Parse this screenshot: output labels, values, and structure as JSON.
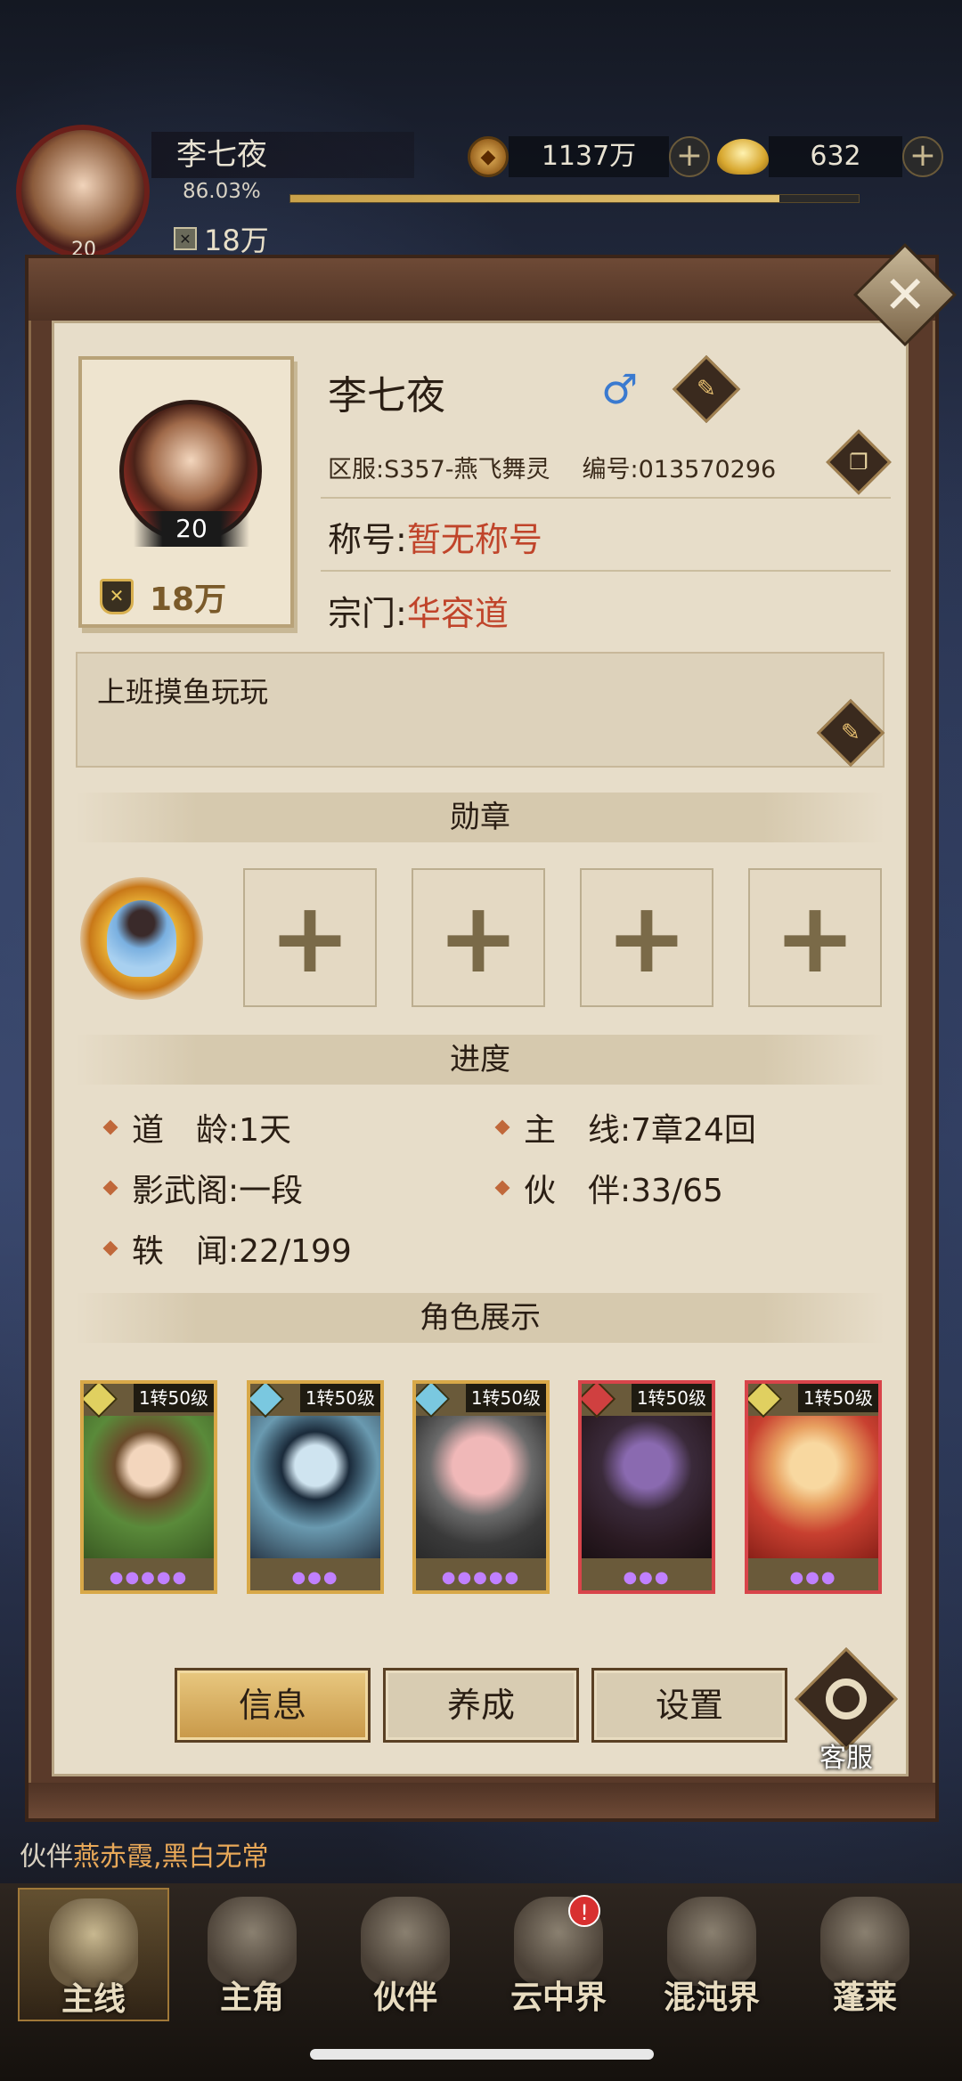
{
  "top": {
    "player_name": "李七夜",
    "level": "20",
    "exp_percent": "86.03%",
    "exp_fraction": 0.8603,
    "power": "18万",
    "coins": "1137万",
    "ingots": "632"
  },
  "profile": {
    "name": "李七夜",
    "gender_icon": "♂",
    "level": "20",
    "power": "18万",
    "server": "区服:S357-燕飞舞灵",
    "id": "编号:013570296",
    "title_label": "称号:",
    "title_value": "暂无称号",
    "sect_label": "宗门:",
    "sect_value": "华容道",
    "signature": "上班摸鱼玩玩"
  },
  "sections": {
    "medals": "勋章",
    "progress": "进度",
    "characters": "角色展示"
  },
  "progress": {
    "dao_age": "道　龄:1天",
    "main_line": "主　线:7章24回",
    "shadow_pavilion": "影武阁:一段",
    "partners": "伙　伴:33/65",
    "iron_news": "轶　闻:22/199"
  },
  "cards": [
    {
      "tag": "1转50级",
      "stars": 5,
      "gem": "yellow",
      "frame": "gold"
    },
    {
      "tag": "1转50级",
      "stars": 3,
      "gem": "blue",
      "frame": "gold"
    },
    {
      "tag": "1转50级",
      "stars": 5,
      "gem": "blue",
      "frame": "gold"
    },
    {
      "tag": "1转50级",
      "stars": 3,
      "gem": "red",
      "frame": "red"
    },
    {
      "tag": "1转50级",
      "stars": 3,
      "gem": "yellow",
      "frame": "red"
    }
  ],
  "tabs": {
    "info": "信息",
    "cultivate": "养成",
    "settings": "设置",
    "service": "客服"
  },
  "chat": {
    "prefix": "伙伴",
    "highlight": "燕赤霞,黑白无常"
  },
  "nav": {
    "main": "主线",
    "hero": "主角",
    "partner": "伙伴",
    "cloud": "云中界",
    "chaos": "混沌界",
    "penglai": "蓬莱",
    "cloud_badge": "!"
  },
  "colors": {
    "accent_red": "#c0442a",
    "gender_blue": "#3a7ad0",
    "gold_frame": "#d8a848",
    "red_frame": "#d8444a"
  }
}
